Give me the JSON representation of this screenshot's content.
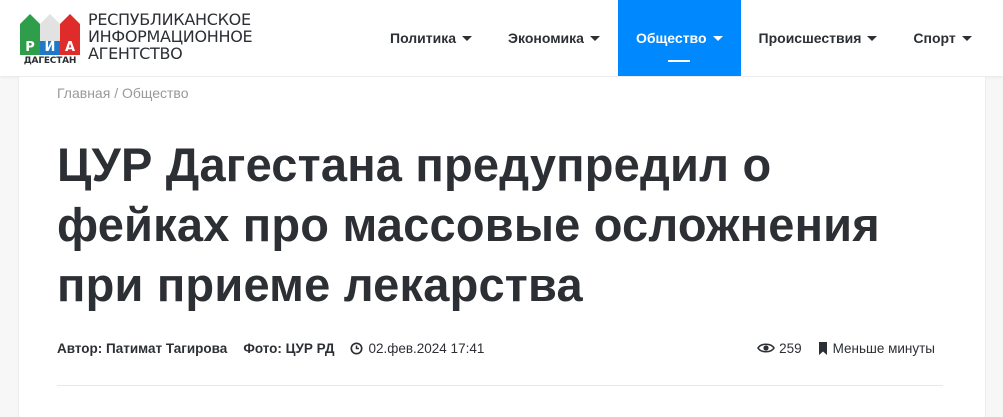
{
  "logo": {
    "ria": [
      "Р",
      "И",
      "А"
    ],
    "region": "ДАГЕСТАН",
    "text_lines": [
      "РЕСПУБЛИКАНСКОЕ",
      "ИНФОРМАЦИОННОЕ",
      "АГЕНТСТВО"
    ],
    "colors": [
      "#2e9e4a",
      "#e2e2e2",
      "#1f78c8",
      "#e02b2b"
    ]
  },
  "nav": {
    "items": [
      {
        "label": "Политика"
      },
      {
        "label": "Экономика"
      },
      {
        "label": "Общество"
      },
      {
        "label": "Происшествия"
      },
      {
        "label": "Спорт"
      }
    ],
    "active_index": 2,
    "accent": "#0088ff"
  },
  "breadcrumb": {
    "home": "Главная",
    "separator": "/",
    "current": "Общество"
  },
  "article": {
    "title_lines": [
      "ЦУР Дагестана предупредил о",
      "фейках про массовые осложнения",
      "при приеме лекарства"
    ],
    "author": "Автор: Патимат Тагирова",
    "photo": "Фото: ЦУР РД",
    "date": "02.фев.2024 17:41",
    "views": "259",
    "read_time": "Меньше минуты"
  }
}
